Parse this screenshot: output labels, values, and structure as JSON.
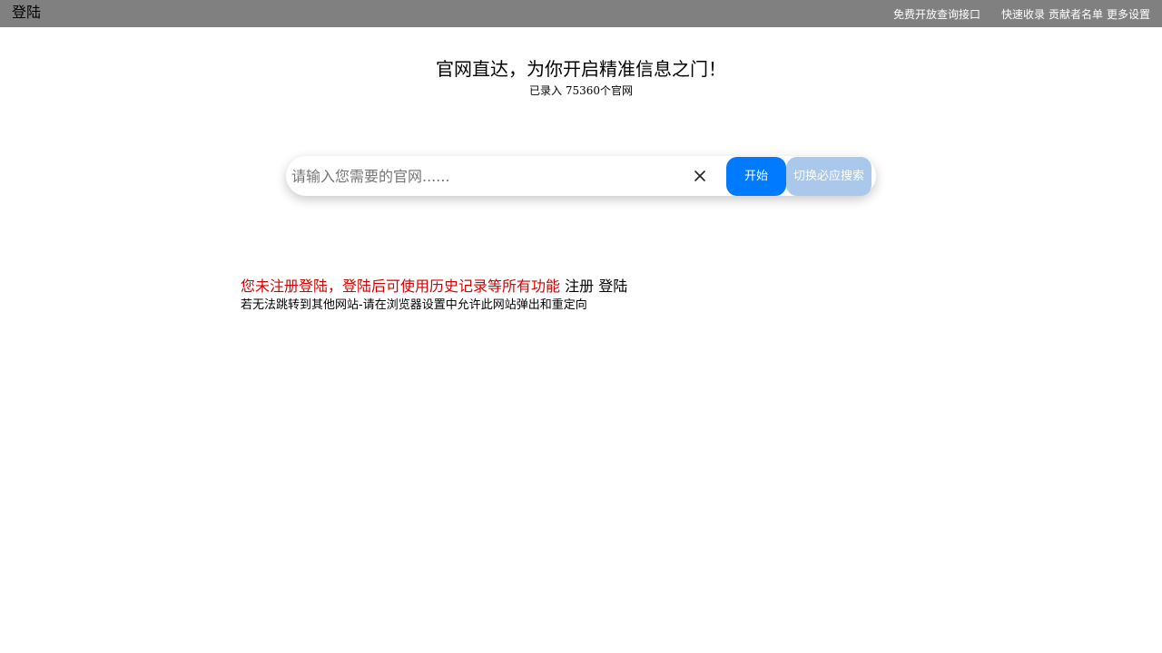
{
  "header": {
    "login_label": "登陆",
    "nav": {
      "api_label": "免费开放查询接口",
      "quick_add_label": "快速收录",
      "contributors_label": "贡献者名单",
      "settings_label": "更多设置"
    },
    "background_color": "#808080"
  },
  "hero": {
    "title": "官网直达，为你开启精准信息之门！",
    "subtitle": "已录入 75360个官网"
  },
  "search": {
    "placeholder": "请输入您需要的官网......",
    "value": "",
    "clear_icon": "close-icon",
    "start_label": "开始",
    "switch_label": "切换必应搜索",
    "start_color": "#007bff",
    "switch_color": "#a9c8ec"
  },
  "notice": {
    "warning": "您未注册登陆，登陆后可使用历史记录等所有功能",
    "register_label": "注册",
    "login_label": "登陆",
    "warning_color": "#d60000",
    "hint": "若无法跳转到其他网站-请在浏览器设置中允许此网站弹出和重定向"
  }
}
